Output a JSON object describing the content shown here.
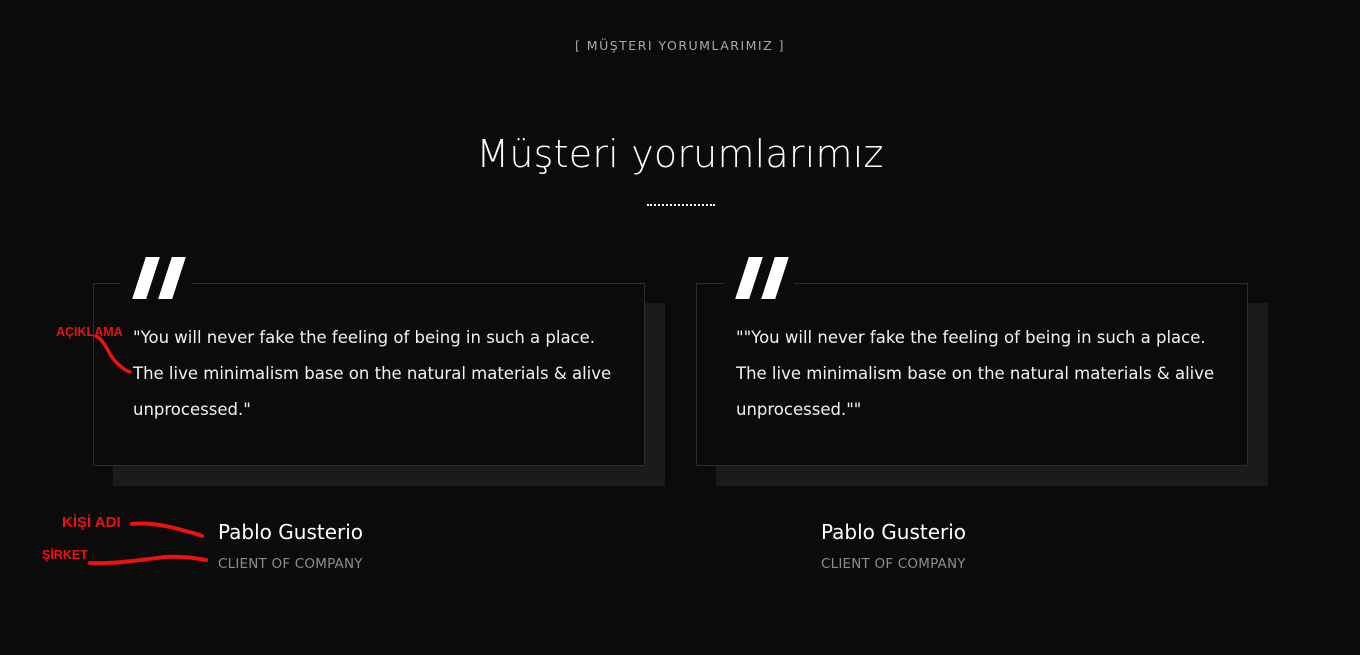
{
  "section": {
    "eyebrow": "[ MÜŞTERI YORUMLARIMIZ ]",
    "title": "Müşteri yorumlarımız"
  },
  "testimonials": [
    {
      "quote": "\"You will never fake the feeling of being in such a place. The live minimalism base on the natural materials & alive unprocessed.\"",
      "name": "Pablo Gusterio",
      "company": "CLIENT OF COMPANY"
    },
    {
      "quote": "\"\"You will never fake the feeling of being in such a place. The live minimalism base on the natural materials & alive unprocessed.\"\"",
      "name": "Pablo Gusterio",
      "company": "CLIENT OF COMPANY"
    }
  ],
  "annotations": {
    "description": "AÇIKLAMA",
    "person_name": "KİŞİ ADI",
    "company": "ŞİRKET",
    "color": "#ee1111"
  },
  "colors": {
    "background": "#0b0b0c",
    "card_shadow": "#1b1b1c",
    "card_border": "#2c2c2e",
    "muted_text": "#8c8c8c"
  },
  "icons": {
    "quote": "quote-icon"
  }
}
